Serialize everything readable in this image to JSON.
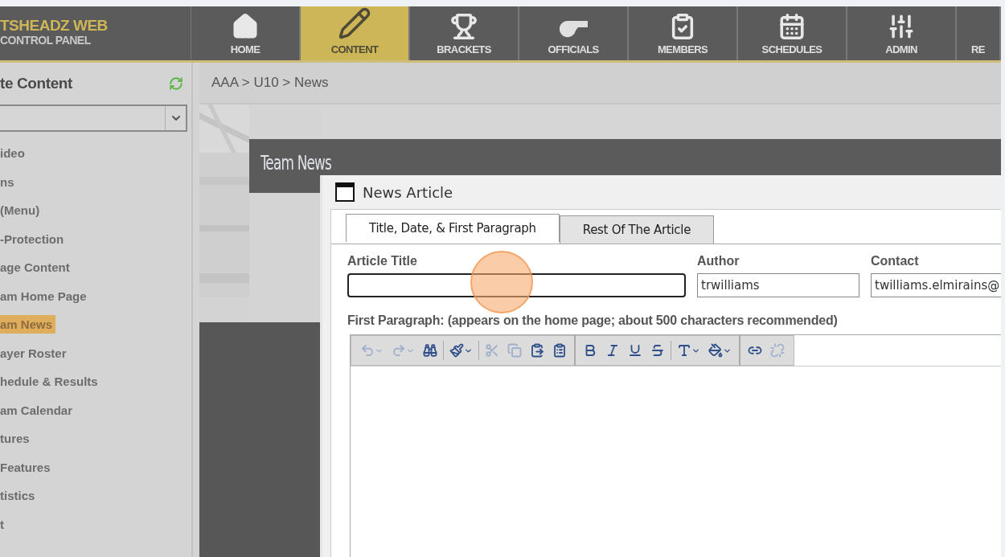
{
  "brand": {
    "line1": "TSHEADZ WEB",
    "line2": "CONTROL PANEL"
  },
  "nav": [
    {
      "label": "HOME",
      "selected": false
    },
    {
      "label": "CONTENT",
      "selected": true
    },
    {
      "label": "BRACKETS",
      "selected": false
    },
    {
      "label": "OFFICIALS",
      "selected": false
    },
    {
      "label": "MEMBERS",
      "selected": false
    },
    {
      "label": "SCHEDULES",
      "selected": false
    },
    {
      "label": "ADMIN",
      "selected": false
    },
    {
      "label": "RE",
      "selected": false
    }
  ],
  "sidebar": {
    "title": "te Content",
    "items": [
      {
        "label": "ideo",
        "selected": false
      },
      {
        "label": "ns",
        "selected": false
      },
      {
        "label": "(Menu)",
        "selected": false
      },
      {
        "label": "-Protection",
        "selected": false
      },
      {
        "label": "age Content",
        "selected": false
      },
      {
        "label": "am Home Page",
        "selected": false
      },
      {
        "label": "am News",
        "selected": true
      },
      {
        "label": "ayer Roster",
        "selected": false
      },
      {
        "label": "hedule & Results",
        "selected": false
      },
      {
        "label": "am Calendar",
        "selected": false
      },
      {
        "label": "tures",
        "selected": false
      },
      {
        "label": "Features",
        "selected": false
      },
      {
        "label": "tistics",
        "selected": false
      },
      {
        "label": "t",
        "selected": false
      }
    ]
  },
  "breadcrumb": "AAA > U10 > News",
  "section_title": "Team News",
  "dialog": {
    "title": "News Article",
    "tabs": [
      {
        "label": "Title, Date, & First Paragraph",
        "selected": true
      },
      {
        "label": "Rest Of The Article",
        "selected": false
      }
    ],
    "fields": [
      {
        "label": "Article Title",
        "focused": true
      },
      {
        "label": "Author",
        "value": "trwilliams",
        "focused": false
      },
      {
        "label": "Contact",
        "value": "twilliams.elmirains@",
        "focused": false
      }
    ],
    "paragraph_label": "First Paragraph: (appears on the home page; about 500 characters recommended)",
    "toolbar": [
      {
        "kind": "button",
        "disabled": true,
        "dropdown": true
      },
      {
        "kind": "button",
        "disabled": true,
        "dropdown": true
      },
      {
        "kind": "button",
        "disabled": false,
        "dropdown": false
      },
      {
        "kind": "separator"
      },
      {
        "kind": "button",
        "disabled": false,
        "dropdown": true
      },
      {
        "kind": "separator"
      },
      {
        "kind": "button",
        "disabled": true,
        "dropdown": false
      },
      {
        "kind": "button",
        "disabled": true,
        "dropdown": false
      },
      {
        "kind": "button",
        "disabled": false,
        "dropdown": false
      },
      {
        "kind": "button",
        "disabled": false,
        "dropdown": false
      },
      {
        "kind": "group"
      },
      {
        "kind": "button",
        "disabled": false,
        "dropdown": false
      },
      {
        "kind": "button",
        "disabled": false,
        "dropdown": false
      },
      {
        "kind": "button",
        "disabled": false,
        "dropdown": false
      },
      {
        "kind": "button",
        "disabled": false,
        "dropdown": false
      },
      {
        "kind": "separator"
      },
      {
        "kind": "button",
        "disabled": false,
        "dropdown": true
      },
      {
        "kind": "button",
        "disabled": false,
        "dropdown": true
      },
      {
        "kind": "group"
      },
      {
        "kind": "button",
        "disabled": false,
        "dropdown": false
      },
      {
        "kind": "button",
        "disabled": true,
        "dropdown": false
      }
    ]
  }
}
